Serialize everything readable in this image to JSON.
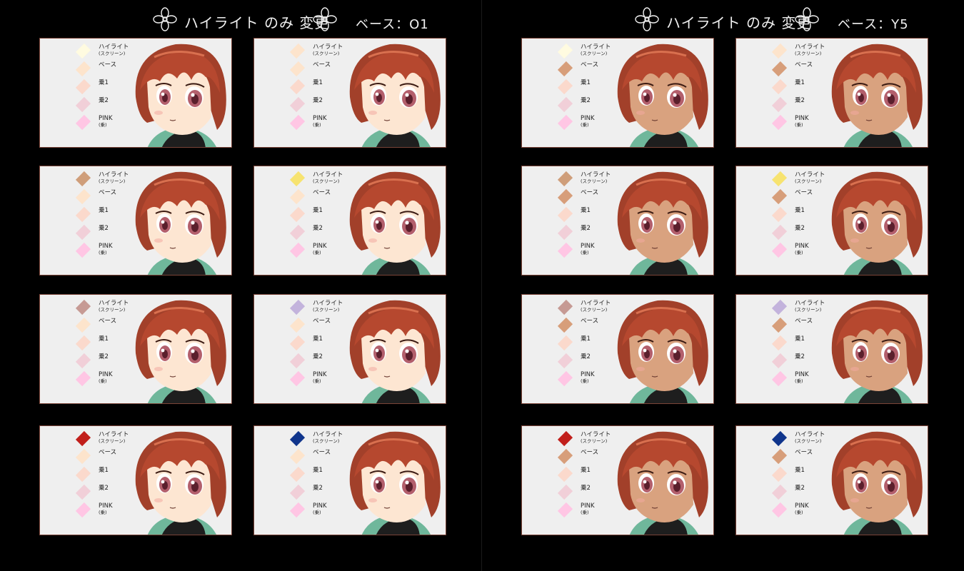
{
  "left_panel": {
    "title": "ハイライト のみ 変更",
    "base_label": "ベース：O1",
    "base_color": "#fde4cc"
  },
  "right_panel": {
    "title": "ハイライト のみ 変更",
    "base_label": "ベース：Y5",
    "base_color": "#d79e7a"
  },
  "swatch_labels": {
    "highlight": "ハイライト",
    "highlight_sub": "(スクリーン)",
    "base": "ベース",
    "mul1": "乗1",
    "mul2": "乗2",
    "pink": "PINK",
    "pink_sub": "(乗)"
  },
  "swatch_colors": {
    "mul1": "#fbd9cc",
    "mul2": "#f1cfd8",
    "pink": "#ffc6e4"
  },
  "highlight_variants": [
    "#fffbe0",
    "#fde4cc",
    "#cf9e7a",
    "#f7e370",
    "#c69a94",
    "#c3b3dc",
    "#c11f1b",
    "#10358c"
  ],
  "skin": {
    "light": "#fde6d2",
    "tan": "#d9a27f"
  },
  "icons": {
    "flower": "flower-icon",
    "character": "character-illustration"
  }
}
